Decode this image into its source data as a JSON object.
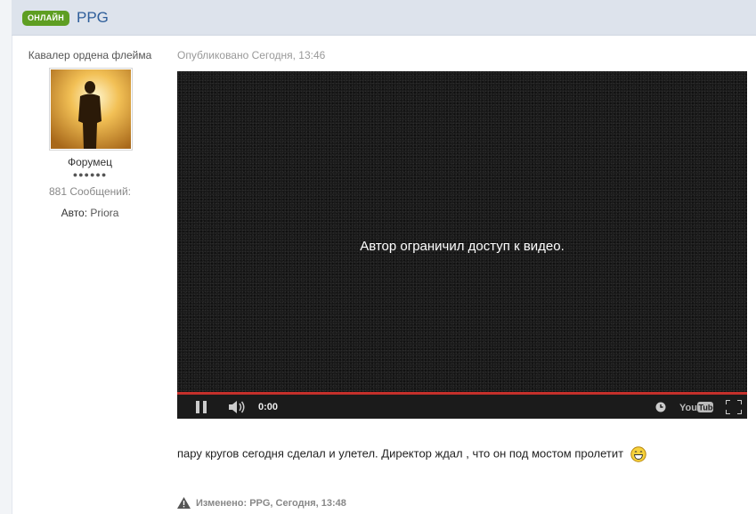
{
  "header": {
    "status_badge": "ОНЛАЙН",
    "author_name": "PPG"
  },
  "author": {
    "title": "Кавалер ордена флейма",
    "rank": "Форумец",
    "pips": "●●●●●●",
    "posts_count": "881 Сообщений:",
    "car_label": "Авто:",
    "car_value": "Priora"
  },
  "post": {
    "date": "Опубликовано Сегодня, 13:46",
    "text": "пару кругов сегодня сделал и улетел. Директор ждал , что он под мостом пролетит",
    "edit_note": "Изменено: PPG, Сегодня, 13:48"
  },
  "video": {
    "message": "Автор ограничил доступ к видео.",
    "time": "0:00",
    "progress": 1.0,
    "icons": [
      "pause-icon",
      "volume-icon",
      "watch-later-icon",
      "youtube-logo",
      "fullscreen-icon"
    ]
  },
  "colors": {
    "header_bg": "#dde3ec",
    "badge_green": "#5e9e22",
    "link_blue": "#2e5e9a",
    "progress_red": "#c4302b"
  }
}
